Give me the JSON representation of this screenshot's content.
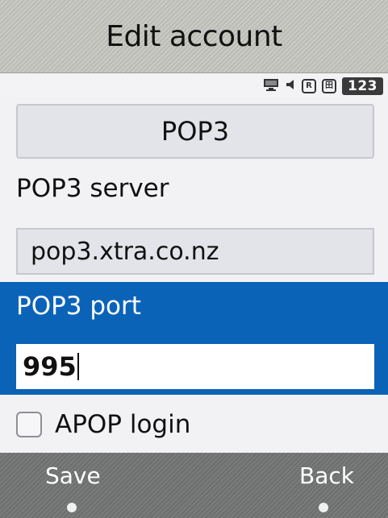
{
  "header": {
    "title": "Edit account"
  },
  "status_bar": {
    "icons": [
      "monitor-icon",
      "speaker-icon",
      "roaming-badge-icon",
      "sim-badge-icon"
    ],
    "badge_r": "R",
    "badge_box": "田",
    "clock": "123"
  },
  "form": {
    "protocol": "POP3",
    "server_label": "POP3 server",
    "server_value": "pop3.xtra.co.nz",
    "port_label": "POP3 port",
    "port_value": "995",
    "apop_label": "APOP login",
    "apop_checked": false
  },
  "softkeys": {
    "left": "Save",
    "right": "Back"
  },
  "colors": {
    "highlight": "#0b63b8",
    "title_bg": "#c3c5be",
    "softbar_bg": "#727473"
  }
}
